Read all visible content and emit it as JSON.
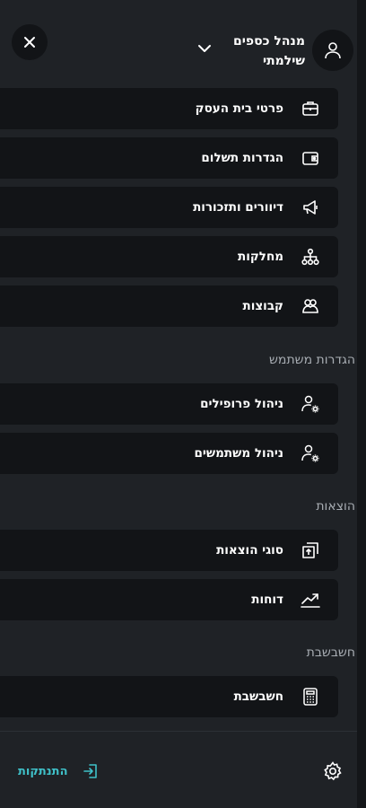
{
  "header": {
    "user_name": "מנהל כספים",
    "user_role": "שילמתי",
    "icons": {
      "close": "close-icon",
      "avatar": "user-icon",
      "chevron": "chevron-down-icon"
    }
  },
  "menu": {
    "items": [
      {
        "label": "פרטי בית העסק",
        "icon": "briefcase-icon"
      },
      {
        "label": "הגדרות תשלום",
        "icon": "wallet-icon"
      },
      {
        "label": "דיוורים ותזכורות",
        "icon": "megaphone-icon"
      },
      {
        "label": "מחלקות",
        "icon": "org-chart-icon"
      },
      {
        "label": "קבוצות",
        "icon": "group-icon"
      }
    ]
  },
  "sections": [
    {
      "title": "הגדרות משתמש",
      "items": [
        {
          "label": "ניהול פרופילים",
          "icon": "user-settings-icon"
        },
        {
          "label": "ניהול משתמשים",
          "icon": "user-settings-icon"
        }
      ]
    },
    {
      "title": "הוצאות",
      "items": [
        {
          "label": "סוגי הוצאות",
          "icon": "upload-icon"
        },
        {
          "label": "דוחות",
          "icon": "trend-chart-icon"
        }
      ]
    },
    {
      "title": "חשבשבת",
      "items": [
        {
          "label": "חשבשבת",
          "icon": "calculator-icon"
        }
      ]
    }
  ],
  "footer": {
    "logout_label": "התנתקות",
    "logout_icon": "logout-icon",
    "settings_icon": "gear-icon"
  },
  "colors": {
    "background": "#1f2226",
    "card": "#121417",
    "accent": "#3fc1c9",
    "section_title": "#a8adb3"
  }
}
